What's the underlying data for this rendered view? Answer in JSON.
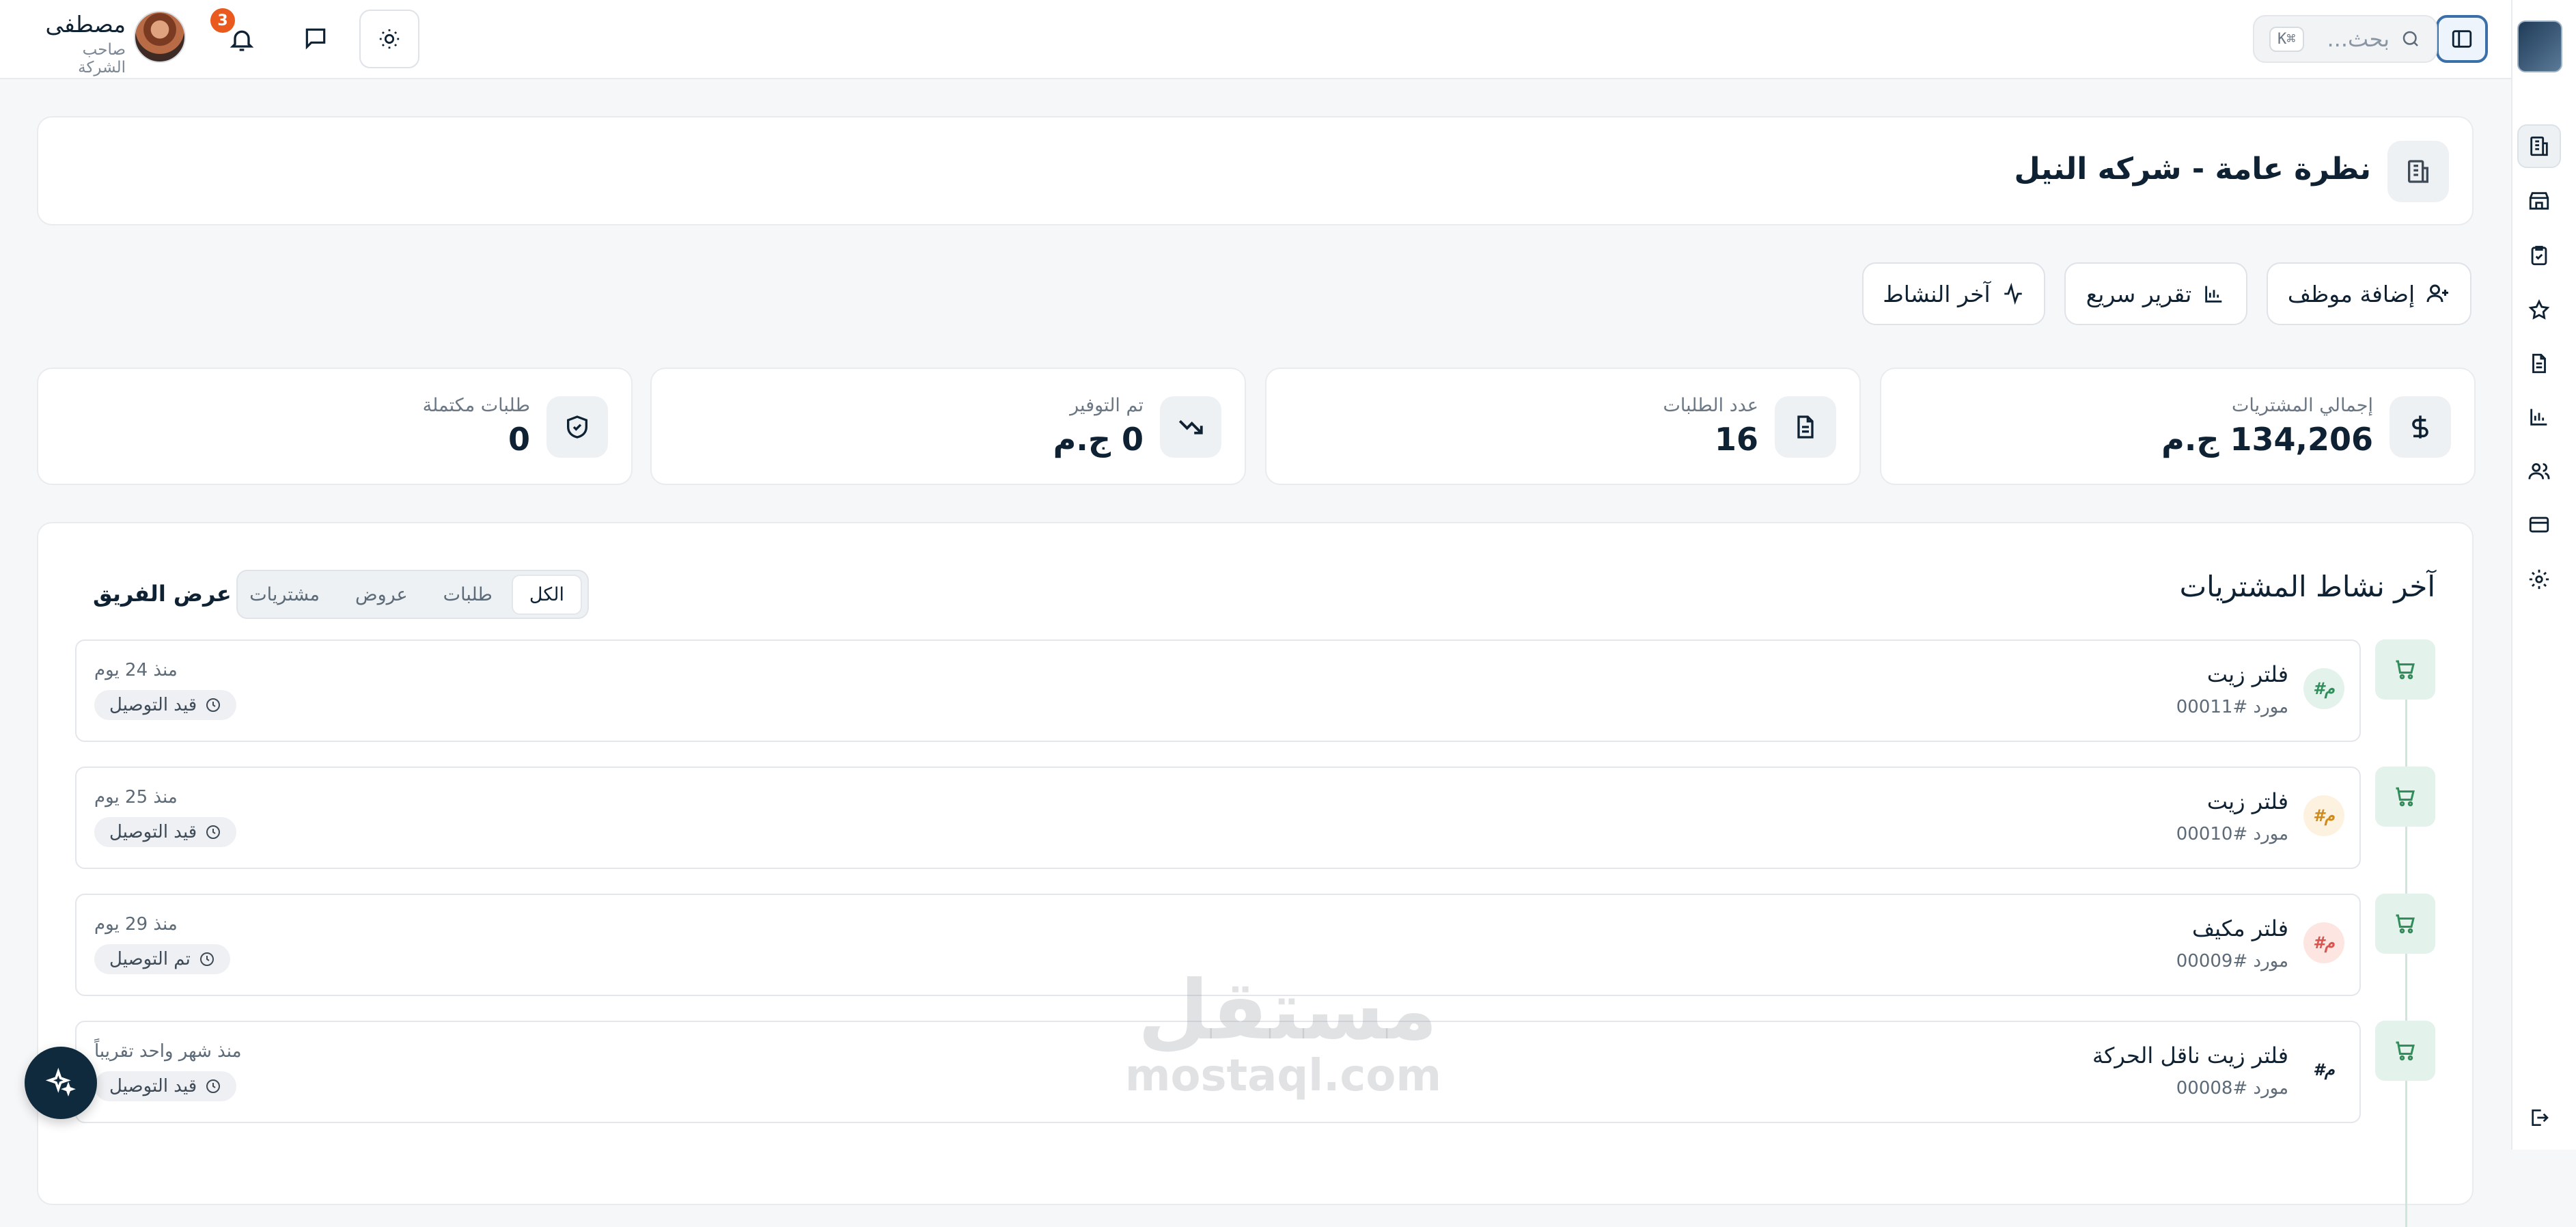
{
  "topbar": {
    "search_placeholder": "بحث...",
    "search_shortcut": "⌘K",
    "notification_count": "3",
    "user_name": "مصطفى",
    "user_role": "صاحب الشركة"
  },
  "page": {
    "title": "نظرة عامة - شركه النيل"
  },
  "actions": {
    "add_employee": "إضافة موظف",
    "quick_report": "تقرير سريع",
    "latest_activity": "آخر النشاط"
  },
  "stats": [
    {
      "label": "إجمالي المشتريات",
      "value": "134,206 ج.م",
      "icon": "dollar-icon"
    },
    {
      "label": "عدد الطلبات",
      "value": "16",
      "icon": "document-icon"
    },
    {
      "label": "تم التوفير",
      "value": "0 ج.م",
      "icon": "trending-down-icon"
    },
    {
      "label": "طلبات مكتملة",
      "value": "0",
      "icon": "shield-check-icon"
    }
  ],
  "activity": {
    "title": "آخر نشاط المشتريات",
    "team_link": "عرض الفريق",
    "tabs": [
      "الكل",
      "طلبات",
      "عروض",
      "مشتريات"
    ],
    "active_tab": "الكل",
    "items": [
      {
        "title": "فلتر زيت",
        "supplier": "مورد #00011",
        "time": "منذ 24 يوم",
        "status": "قيد التوصيل",
        "badge": "م#",
        "badge_bg": "#e3f2ea",
        "badge_color": "#2f8f5b"
      },
      {
        "title": "فلتر زيت",
        "supplier": "مورد #00010",
        "time": "منذ 25 يوم",
        "status": "قيد التوصيل",
        "badge": "م#",
        "badge_bg": "#fdf2df",
        "badge_color": "#d08a1a"
      },
      {
        "title": "فلتر مكيف",
        "supplier": "مورد #00009",
        "time": "منذ 29 يوم",
        "status": "تم التوصيل",
        "badge": "م#",
        "badge_bg": "#fde6e2",
        "badge_color": "#d9534f"
      },
      {
        "title": "فلتر زيت ناقل الحركة",
        "supplier": "مورد #00008",
        "time": "منذ شهر واحد تقريباً",
        "status": "قيد التوصيل",
        "badge": "م#",
        "badge_bg": "#ffffff",
        "badge_color": "#0f2233"
      }
    ]
  },
  "watermark": {
    "arabic": "مستقل",
    "latin": "mostaql.com"
  },
  "colors": {
    "primary_dark": "#0f2233",
    "accent_green": "#2f8f5b",
    "badge_orange": "#ea5a1f",
    "focus_blue": "#3a6fa8"
  }
}
